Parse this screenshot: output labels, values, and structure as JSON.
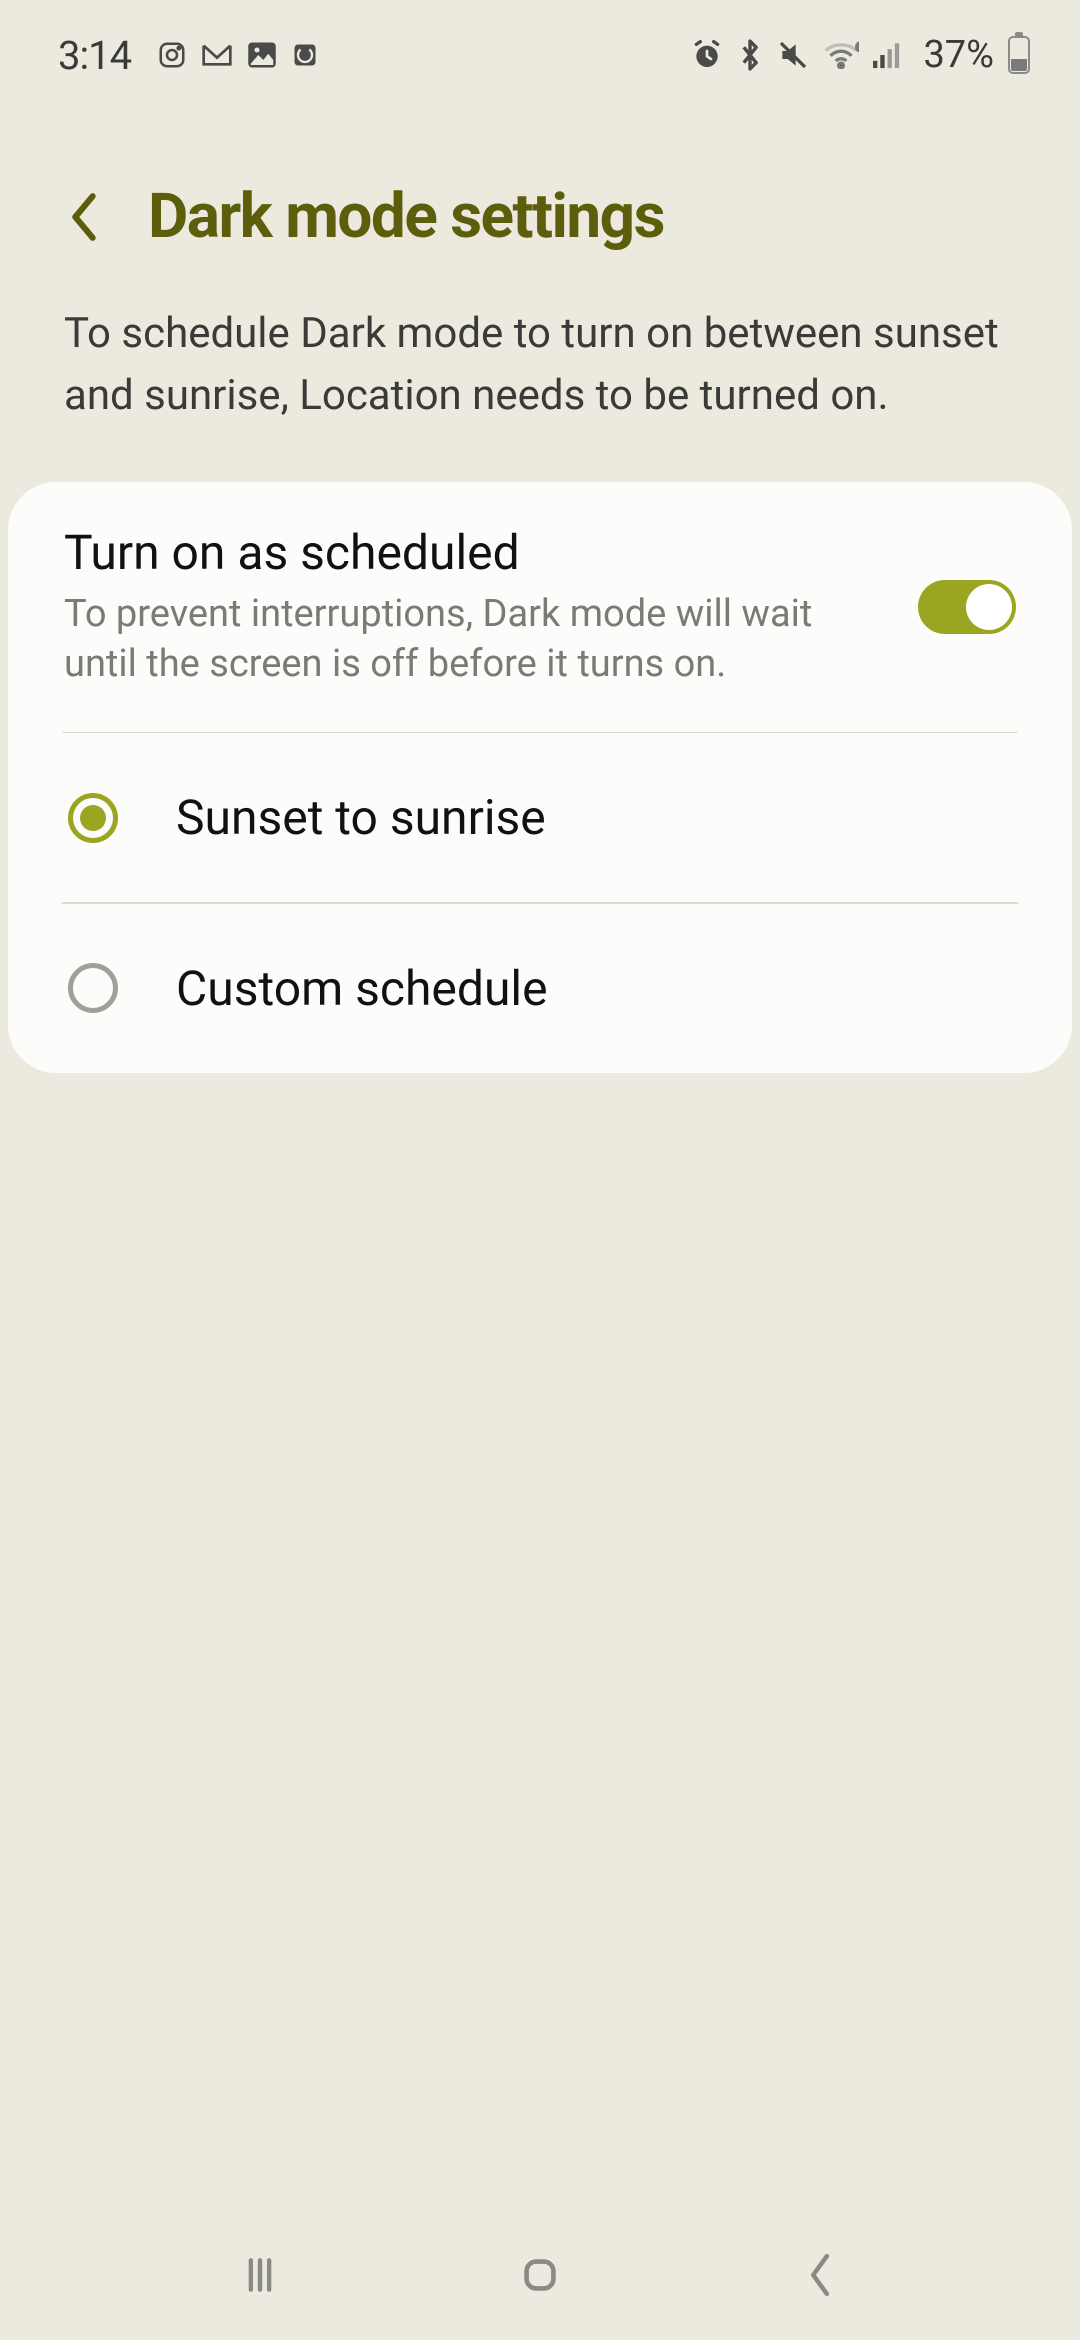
{
  "status": {
    "time": "3:14",
    "battery_text": "37%",
    "icons_left": [
      "instagram-icon",
      "gmail-icon",
      "photos-icon",
      "data-saver-icon"
    ],
    "icons_right": [
      "alarm-icon",
      "bluetooth-icon",
      "mute-icon",
      "wifi-icon",
      "signal-icon"
    ]
  },
  "header": {
    "title": "Dark mode settings"
  },
  "description": "To schedule Dark mode to turn on between sunset and sunrise, Location needs to be turned on.",
  "card": {
    "toggle": {
      "title": "Turn on as scheduled",
      "subtitle": "To prevent interruptions, Dark mode will wait until the screen is off before it turns on.",
      "on": true
    },
    "options": [
      {
        "label": "Sunset to sunrise",
        "selected": true
      },
      {
        "label": "Custom schedule",
        "selected": false
      }
    ]
  },
  "colors": {
    "accent": "#9aa521",
    "title": "#5c5e0c",
    "bg": "#eceade",
    "card": "#fcfcfa"
  }
}
